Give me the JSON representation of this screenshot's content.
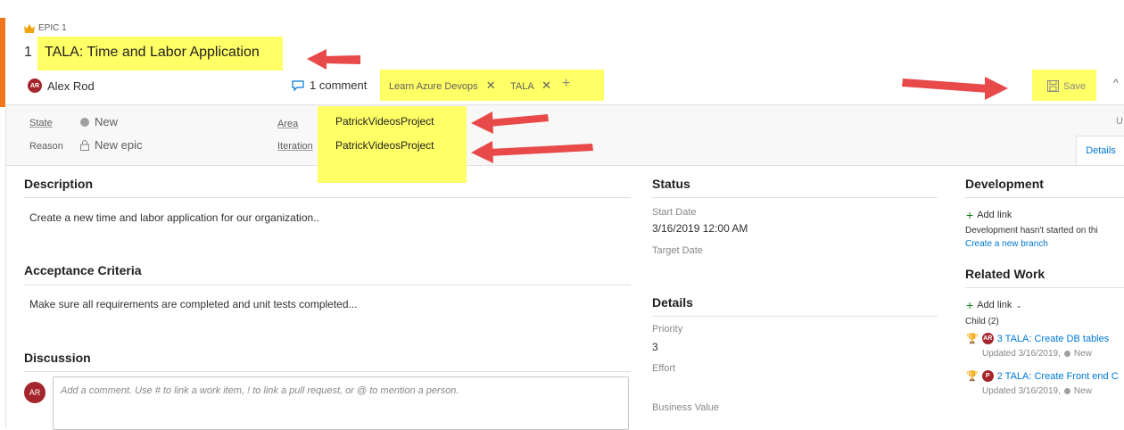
{
  "header": {
    "work_item_type": "EPIC 1",
    "id": "1",
    "title": "TALA: Time and Labor Application",
    "author_initials": "AR",
    "author_name": "Alex Rod",
    "comment_count": "1 comment",
    "tags": [
      "Learn Azure Devops",
      "TALA"
    ],
    "save_label": "Save",
    "caret": "^"
  },
  "fields": {
    "state_label": "State",
    "state_value": "New",
    "reason_label": "Reason",
    "reason_value": "New epic",
    "area_label": "Area",
    "area_value": "PatrickVideosProject",
    "iteration_label": "Iteration",
    "iteration_value": "PatrickVideosProject",
    "right_edge_label": "U"
  },
  "tabs": {
    "details": "Details"
  },
  "description": {
    "title": "Description",
    "text": "Create a new time and labor application for our organization.."
  },
  "acceptance": {
    "title": "Acceptance Criteria",
    "text": "Make sure all requirements are completed and unit tests completed..."
  },
  "discussion": {
    "title": "Discussion",
    "avatar": "AR",
    "placeholder": "Add a comment. Use # to link a work item, ! to link a pull request, or @ to mention a person."
  },
  "status": {
    "title": "Status",
    "start_date_label": "Start Date",
    "start_date_value": "3/16/2019 12:00 AM",
    "target_date_label": "Target Date"
  },
  "details": {
    "title": "Details",
    "priority_label": "Priority",
    "priority_value": "3",
    "effort_label": "Effort",
    "business_value_label": "Business Value"
  },
  "development": {
    "title": "Development",
    "add_link": "Add link",
    "not_started": "Development hasn't started on thi",
    "create_branch": "Create a new branch"
  },
  "related": {
    "title": "Related Work",
    "add_link": "Add link",
    "child_label": "Child (2)",
    "items": [
      {
        "badge": "AR",
        "title": "3 TALA: Create DB tables",
        "meta": "Updated 3/16/2019,",
        "state": "New"
      },
      {
        "badge": "P",
        "title": "2 TALA: Create Front end C",
        "meta": "Updated 3/16/2019,",
        "state": "New"
      }
    ]
  },
  "colors": {
    "accent": "#f0761e",
    "highlight": "#ffff66",
    "arrow": "#e84a4a",
    "link": "#0078d4"
  }
}
